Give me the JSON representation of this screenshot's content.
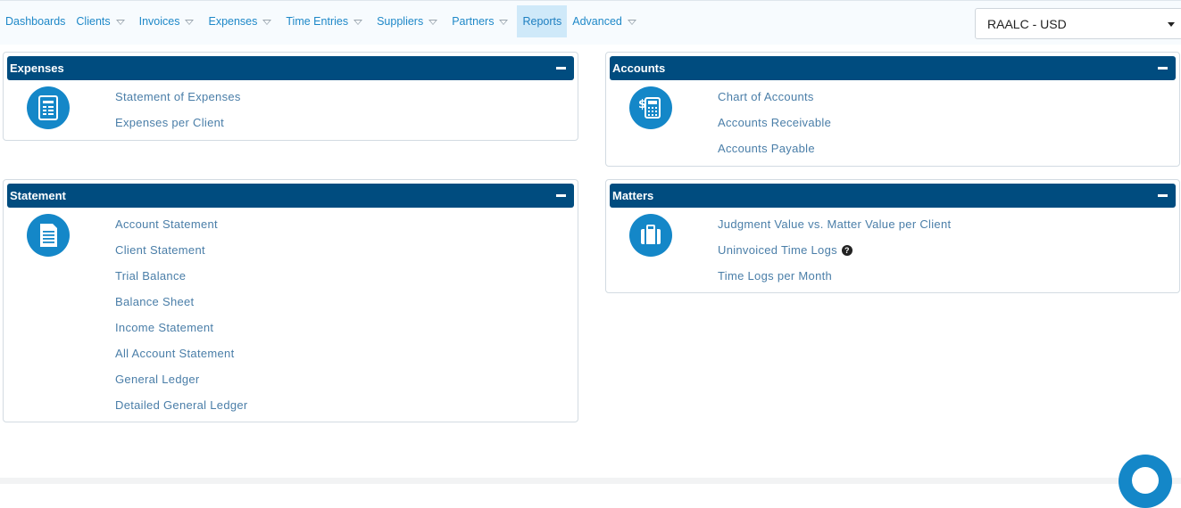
{
  "nav": {
    "items": [
      {
        "label": "Dashboards",
        "dropdown": false,
        "active": false
      },
      {
        "label": "Clients",
        "dropdown": true,
        "active": false
      },
      {
        "label": "Invoices",
        "dropdown": true,
        "active": false
      },
      {
        "label": "Expenses",
        "dropdown": true,
        "active": false
      },
      {
        "label": "Time Entries",
        "dropdown": true,
        "active": false
      },
      {
        "label": "Suppliers",
        "dropdown": true,
        "active": false
      },
      {
        "label": "Partners",
        "dropdown": true,
        "active": false
      },
      {
        "label": "Reports",
        "dropdown": false,
        "active": true
      },
      {
        "label": "Advanced",
        "dropdown": true,
        "active": false
      }
    ],
    "company_select": "RAALC - USD"
  },
  "panels": {
    "expenses": {
      "title": "Expenses",
      "icon": "report-document-icon",
      "links": [
        "Statement of Expenses",
        "Expenses per Client"
      ]
    },
    "accounts": {
      "title": "Accounts",
      "icon": "calculator-dollar-icon",
      "links": [
        "Chart of Accounts",
        "Accounts Receivable",
        "Accounts Payable"
      ]
    },
    "statement": {
      "title": "Statement",
      "icon": "document-lines-icon",
      "links": [
        "Account Statement",
        "Client Statement",
        "Trial Balance",
        "Balance Sheet",
        "Income Statement",
        "All Account Statement",
        "General Ledger",
        "Detailed General Ledger"
      ]
    },
    "matters": {
      "title": "Matters",
      "icon": "briefcase-icon",
      "links": [
        "Judgment Value vs. Matter Value per Client",
        "Uninvoiced Time Logs",
        "Time Logs per Month"
      ],
      "help_glyph": "?"
    }
  },
  "colors": {
    "header_bg": "#004c7f",
    "icon_bg": "#1487c8",
    "link": "#4a7ea8",
    "nav_link": "#1e88c8",
    "nav_active_bg": "#cfe9f9"
  }
}
